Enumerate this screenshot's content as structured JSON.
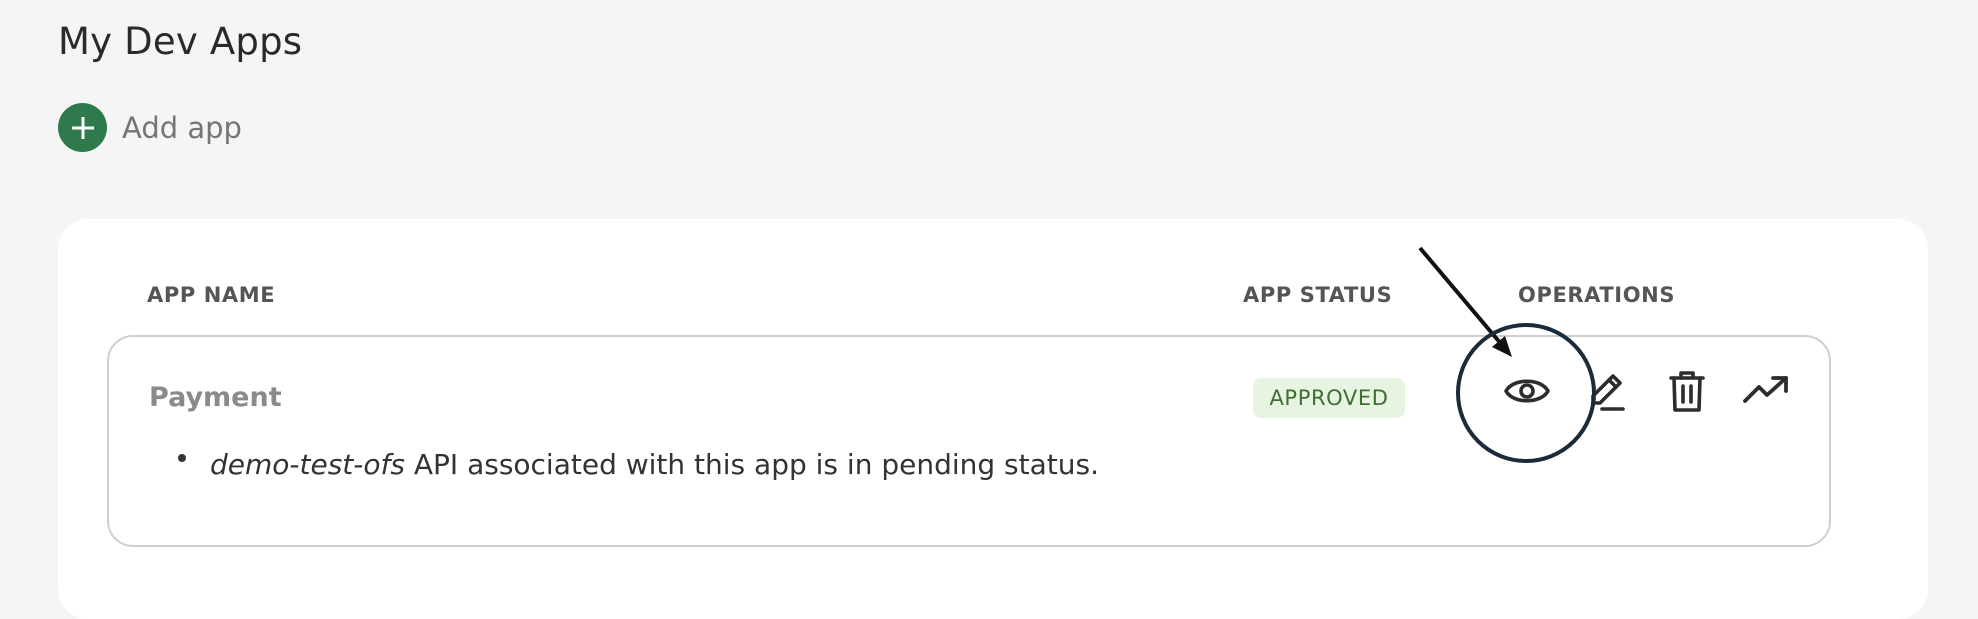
{
  "page": {
    "title": "My Dev Apps",
    "add_app_label": "Add app"
  },
  "table": {
    "columns": [
      "APP NAME",
      "APP STATUS",
      "OPERATIONS"
    ],
    "rows": [
      {
        "app_name": "Payment",
        "status": "APPROVED",
        "note_api_name": "demo-test-ofs",
        "note_text": " API associated with this app is in pending status.",
        "operations": [
          "eye-icon",
          "edit-icon",
          "trash-icon",
          "trending-up-icon"
        ]
      }
    ]
  },
  "colors": {
    "accent_green": "#2f7a4c",
    "status_bg": "#e6f4e1",
    "status_text": "#3f6e34"
  }
}
